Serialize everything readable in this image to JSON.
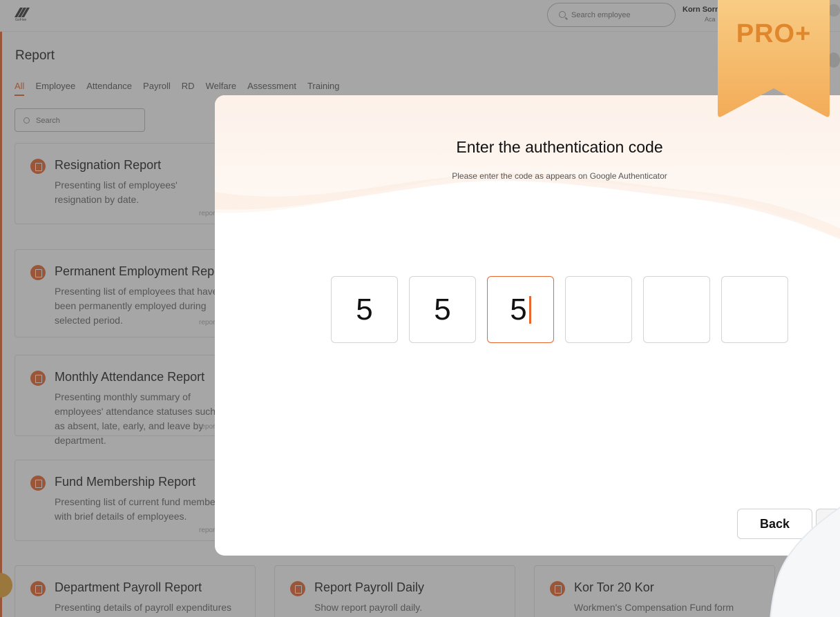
{
  "brand": {
    "logo_text": "GoFive"
  },
  "topbar": {
    "search_placeholder": "Search employee",
    "user_name": "Korn Sorn",
    "user_role": "Aca"
  },
  "page": {
    "title": "Report",
    "tabs": [
      {
        "label": "All",
        "active": true
      },
      {
        "label": "Employee"
      },
      {
        "label": "Attendance"
      },
      {
        "label": "Payroll"
      },
      {
        "label": "RD"
      },
      {
        "label": "Welfare"
      },
      {
        "label": "Assessment"
      },
      {
        "label": "Training"
      }
    ],
    "search_placeholder": "Search"
  },
  "reports": [
    {
      "title": "Resignation Report",
      "desc": "Presenting list of employees' resignation by date.",
      "tag": "report"
    },
    {
      "title": "Permanent Employment Report",
      "desc": "Presenting list of employees that have been permanently employed during selected period.",
      "tag": "report"
    },
    {
      "title": "Monthly Attendance Report",
      "desc": "Presenting monthly summary of employees' attendance statuses such as absent, late, early, and leave by department.",
      "tag": "report"
    },
    {
      "title": "Fund Membership Report",
      "desc": "Presenting list of current fund members with brief details of employees.",
      "tag": "report"
    },
    {
      "title": "Department Payroll Report",
      "desc": "Presenting details of payroll expenditures"
    },
    {
      "title": "Report Payroll Daily",
      "desc": "Show report payroll daily."
    },
    {
      "title": "Kor Tor 20 Kor",
      "desc": "Workmen's Compensation Fund form"
    }
  ],
  "modal": {
    "title": "Enter the authentication code",
    "subtitle": "Please enter the code as appears on Google Authenticator",
    "digits": [
      "5",
      "5",
      "5",
      "",
      "",
      ""
    ],
    "active_index": 2,
    "back_label": "Back"
  },
  "badge": {
    "label": "PRO+"
  },
  "colors": {
    "accent": "#e8672f",
    "badge": "#f4b25c",
    "badge_text": "#e0862c"
  }
}
